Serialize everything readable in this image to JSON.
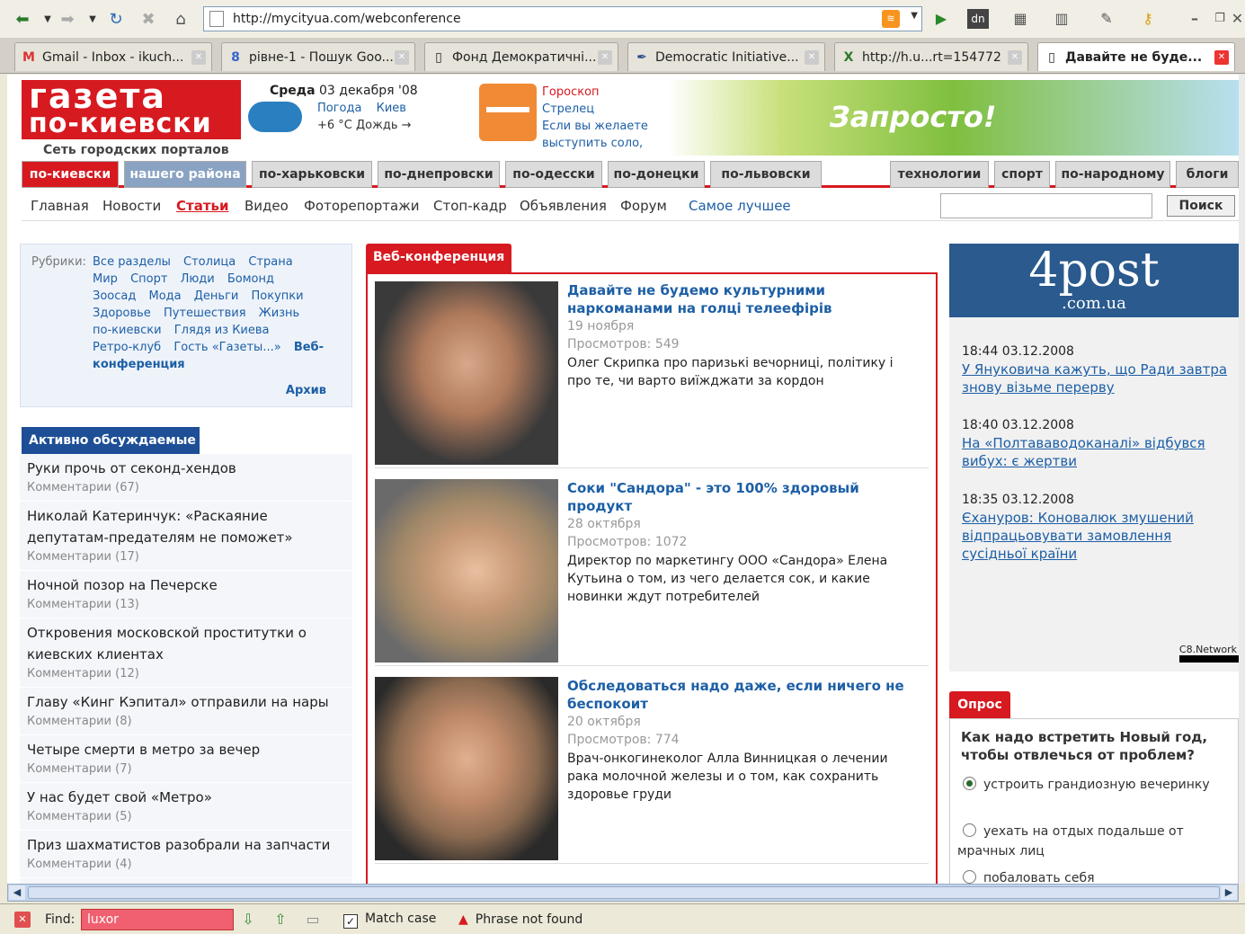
{
  "browser": {
    "url": "http://mycityua.com/webconference",
    "tabs": [
      {
        "label": "Gmail - Inbox - ikuch...",
        "icon": "gmail-icon"
      },
      {
        "label": "рівне-1 - Пошук Goo...",
        "icon": "google-icon"
      },
      {
        "label": "Фонд Демократичні...",
        "icon": "page-icon"
      },
      {
        "label": "Democratic Initiative...",
        "icon": "pen-icon"
      },
      {
        "label": "http://h.u...rt=154772",
        "icon": "excel-icon"
      },
      {
        "label": "Давайте не буде...",
        "icon": "page-icon",
        "active": true
      }
    ]
  },
  "header": {
    "logo_line1": "газета",
    "logo_line2": "по-киевски",
    "logo_sub": "Сеть городских порталов",
    "date_day": "Среда",
    "date_rest": "03 декабря '08",
    "weather_link1": "Погода",
    "weather_link2": "Киев",
    "weather_temp": "+6 °С Дождь →",
    "horoscope": [
      "Гороскоп",
      "Стрелец",
      "Если вы желаете",
      "выступить соло,"
    ],
    "banner_text": "Запросто!"
  },
  "nav1": {
    "left": [
      "по-киевски",
      "нашего района",
      "по-харьковски",
      "по-днепровски",
      "по-одесски",
      "по-донецки",
      "по-львовски"
    ],
    "right": [
      "технологии",
      "спорт",
      "по-народному",
      "блоги"
    ]
  },
  "nav2": {
    "items": [
      "Главная",
      "Новости",
      "Статьи",
      "Видео",
      "Фоторепортажи",
      "Стоп-кадр",
      "Объявления",
      "Форум",
      "Самое лучшее"
    ],
    "search_button": "Поиск",
    "search_value": ""
  },
  "rubrics": {
    "label": "Рубрики:",
    "items": [
      "Все разделы",
      "Столица",
      "Страна",
      "Мир",
      "Спорт",
      "Люди",
      "Бомонд",
      "Зоосад",
      "Мода",
      "Деньги",
      "Покупки",
      "Здоровье",
      "Путешествия",
      "Жизнь",
      "по-киевски",
      "Глядя из Киева",
      "Ретро-клуб",
      "Гость «Газеты...»"
    ],
    "current": "Веб-конференция",
    "archive": "Архив"
  },
  "active": {
    "title": "Активно обсуждаемые",
    "items": [
      {
        "title": "Руки прочь от секонд-хендов",
        "comments": "Комментарии (67)"
      },
      {
        "title": "Николай Катеринчук: «Раскаяние депутатам-предателям не поможет»",
        "comments": "Комментарии (17)"
      },
      {
        "title": "Ночной позор на Печерске",
        "comments": "Комментарии (13)"
      },
      {
        "title": "Откровения московской проститутки о киевских клиентах",
        "comments": "Комментарии (12)"
      },
      {
        "title": "Главу «Кинг Кэпитал» отправили на нары",
        "comments": "Комментарии (8)"
      },
      {
        "title": "Четыре смерти в метро за вечер",
        "comments": "Комментарии (7)"
      },
      {
        "title": "У нас будет свой «Метро»",
        "comments": "Комментарии (5)"
      },
      {
        "title": "Приз шахматистов разобрали на запчасти",
        "comments": "Комментарии (4)"
      }
    ]
  },
  "conference": {
    "tab": "Веб-конференция",
    "articles": [
      {
        "title": "Давайте не будемо культурними наркоманами на голці телеефірів",
        "date": "19 ноября",
        "views": "Просмотров: 549",
        "desc": "Олег Скрипка про паризькі вечорниці, політику і про те, чи варто виїжджати за кордон"
      },
      {
        "title": "Соки \"Сандора\" - это 100% здоровый продукт",
        "date": "28 октября",
        "views": "Просмотров: 1072",
        "desc": "Директор по маркетингу ООО «Сандора» Елена Кутьина о том, из чего делается сок, и какие новинки ждут потребителей"
      },
      {
        "title": "Обследоваться надо даже, если ничего не беспокоит",
        "date": "20 октября",
        "views": "Просмотров: 774",
        "desc": "Врач-онкогинеколог Алла Винницкая о лечении рака молочной железы и о том, как сохранить здоровье груди"
      }
    ]
  },
  "news": {
    "logo": "4post",
    "logo_sub": ".com.ua",
    "items": [
      {
        "time": "18:44 03.12.2008",
        "title": "У Януковича кажуть, що Ради завтра знову візьме перерву"
      },
      {
        "time": "18:40 03.12.2008",
        "title": "На «Полтававодоканалі» відбувся вибух: є жертви"
      },
      {
        "time": "18:35 03.12.2008",
        "title": "Єханурoв: Коновалюк змушений відпрацьовувати замовлення сусідньої країни"
      }
    ],
    "network": "C8.Network"
  },
  "poll": {
    "tab": "Опрос",
    "question": "Как надо встретить Новый год, чтобы отвлечься от проблем?",
    "options": [
      "устроить грандиозную вечеринку",
      "уехать на отдых подальше от мрачных лиц",
      "побаловать себя"
    ]
  },
  "findbar": {
    "label": "Find:",
    "value": "luxor",
    "match_case": "Match case",
    "status": "Phrase not found"
  }
}
